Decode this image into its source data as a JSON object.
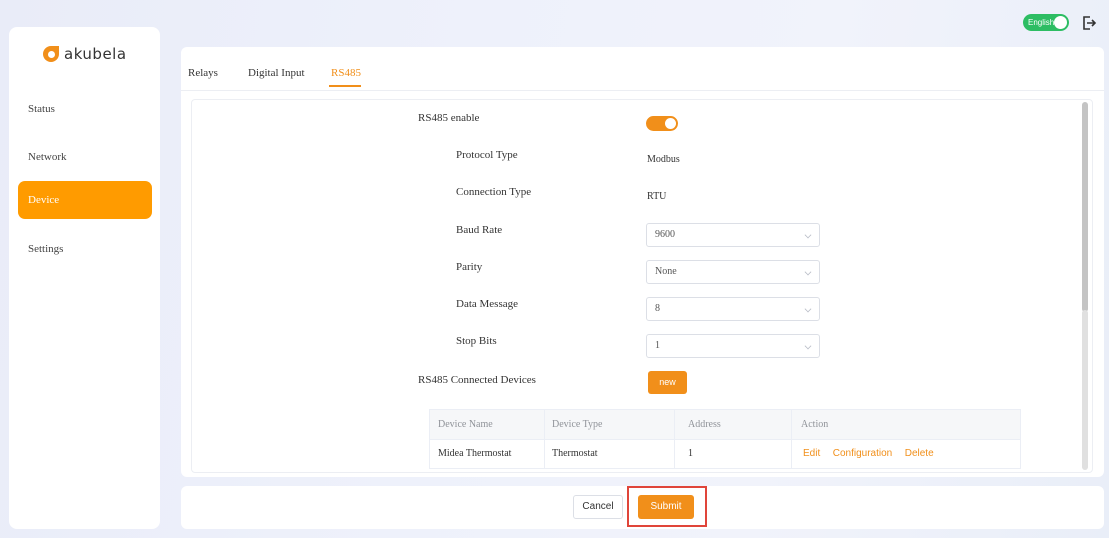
{
  "header": {
    "language_label": "English",
    "logout_icon": "logout-icon"
  },
  "brand": {
    "name": "akubela",
    "logo_color": "#f18f1a"
  },
  "sidebar": {
    "items": [
      {
        "label": "Status"
      },
      {
        "label": "Network"
      },
      {
        "label": "Device",
        "active": true
      },
      {
        "label": "Settings"
      }
    ]
  },
  "tabs": [
    {
      "label": "Relays"
    },
    {
      "label": "Digital Input"
    },
    {
      "label": "RS485",
      "active": true
    }
  ],
  "form": {
    "rs485_enable_label": "RS485 enable",
    "rs485_enabled": true,
    "protocol_type_label": "Protocol Type",
    "protocol_type_value": "Modbus",
    "connection_type_label": "Connection Type",
    "connection_type_value": "RTU",
    "baud_rate_label": "Baud Rate",
    "baud_rate_value": "9600",
    "parity_label": "Parity",
    "parity_value": "None",
    "data_message_label": "Data Message",
    "data_message_value": "8",
    "stop_bits_label": "Stop Bits",
    "stop_bits_value": "1",
    "connected_devices_label": "RS485 Connected Devices",
    "new_button_label": "new"
  },
  "devices_table": {
    "columns": [
      "Device Name",
      "Device Type",
      "Address",
      "Action"
    ],
    "rows": [
      {
        "name": "Midea Thermostat",
        "type": "Thermostat",
        "address": "1",
        "actions": [
          "Edit",
          "Configuration",
          "Delete"
        ]
      }
    ]
  },
  "footer": {
    "cancel_label": "Cancel",
    "submit_label": "Submit"
  },
  "colors": {
    "accent": "#f18f1a",
    "active_nav": "#ff9b00",
    "toggle_green": "#2dbd63",
    "highlight_red": "#e0453a"
  }
}
